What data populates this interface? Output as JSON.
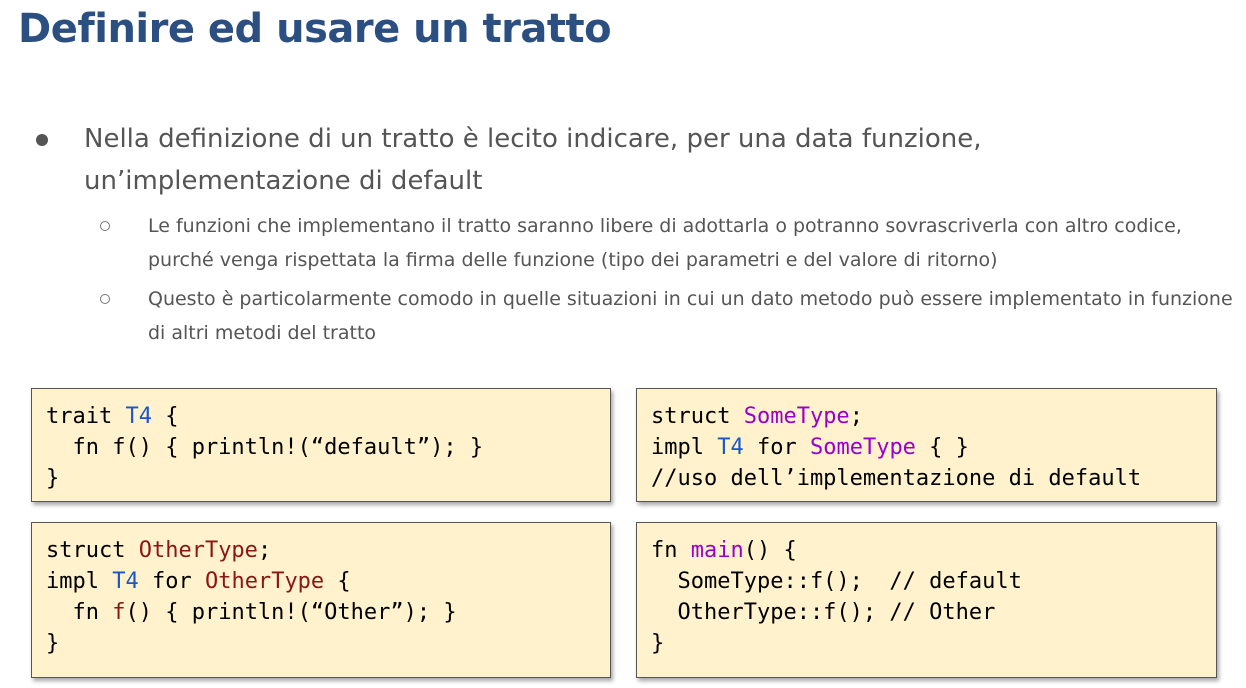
{
  "slide": {
    "title": "Definire ed usare un tratto",
    "bullet": "Nella definizione di un tratto è lecito indicare, per una data funzione, un’implementazione di default",
    "subbullets": [
      "Le funzioni che implementano il tratto saranno libere di adottarla o potranno sovrascriverla con altro codice, purché venga rispettata la firma delle funzione (tipo dei parametri e del valore di ritorno)",
      "Questo è particolarmente comodo in quelle situazioni in cui un dato metodo può essere implementato in funzione di altri metodi del tratto"
    ]
  },
  "code_blocks": {
    "trait_def": [
      [
        "trait ",
        "T4",
        " {"
      ],
      [
        "  fn f() { println!(“default”); }"
      ],
      [
        "}"
      ]
    ],
    "some_type": [
      [
        "struct ",
        "SomeType",
        ";"
      ],
      [
        "impl ",
        "T4",
        " for ",
        "SomeType",
        " { }"
      ],
      [
        "//uso dell’implementazione di default"
      ]
    ],
    "other_type": [
      [
        "struct ",
        "OtherType",
        ";"
      ],
      [
        "impl ",
        "T4",
        " for ",
        "OtherType",
        " {"
      ],
      [
        "  fn ",
        "f",
        "() { println!(“Other”); }"
      ],
      [
        "}"
      ]
    ],
    "main_fn": [
      [
        "fn ",
        "main",
        "() {"
      ],
      [
        "  SomeType::f();  // default"
      ],
      [
        "  OtherType::f(); // Other"
      ],
      [
        "}"
      ]
    ]
  },
  "colors": {
    "title": "#2b4f81",
    "code_bg": "#fff2cc",
    "trait_name": "#1a56c9",
    "type_name_some": "#9900cc",
    "type_name_other": "#8a1616",
    "fn_name": "#9900cc"
  }
}
